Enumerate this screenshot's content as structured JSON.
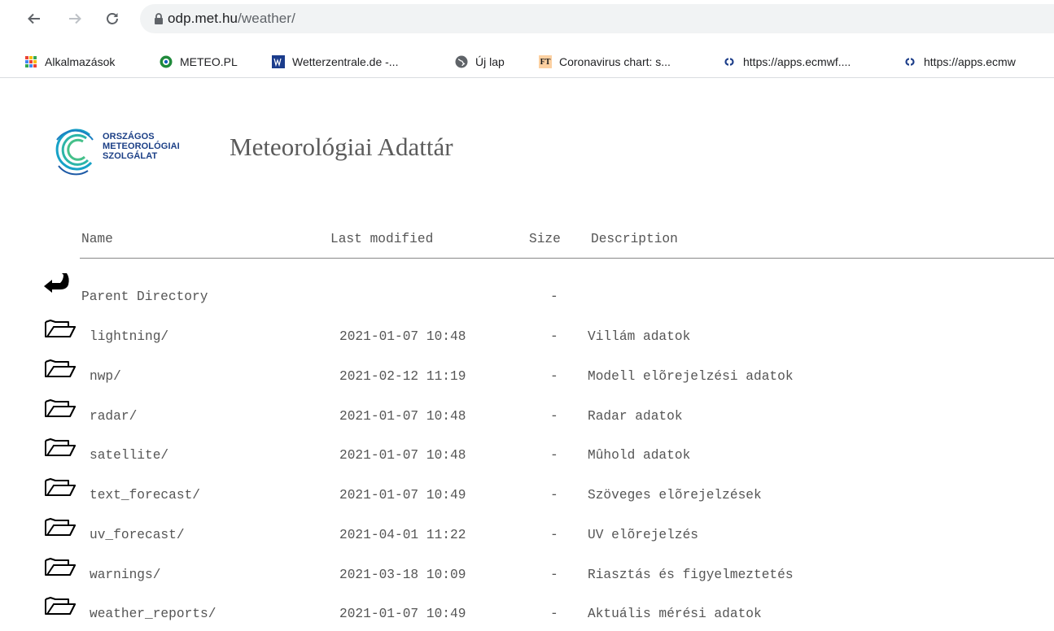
{
  "browser": {
    "url_host": "odp.met.hu",
    "url_path": "/weather/",
    "bookmarks": [
      {
        "label": "Alkalmazások",
        "icon": "apps-grid-icon"
      },
      {
        "label": "METEO.PL",
        "icon": "meteo-pl-icon"
      },
      {
        "label": "Wetterzentrale.de -...",
        "icon": "wetterzentrale-icon"
      },
      {
        "label": "Új lap",
        "icon": "globe-icon"
      },
      {
        "label": "Coronavirus chart: s...",
        "icon": "ft-icon"
      },
      {
        "label": "https://apps.ecmwf....",
        "icon": "ecmwf-icon"
      },
      {
        "label": "https://apps.ecmw",
        "icon": "ecmwf-icon"
      }
    ]
  },
  "site": {
    "logo_lines": [
      "ORSZÁGOS",
      "METEOROLÓGIAI",
      "SZOLGÁLAT"
    ],
    "title": "Meteorológiai Adattár"
  },
  "table": {
    "headers": {
      "name": "Name",
      "modified": "Last modified",
      "size": "Size",
      "description": "Description"
    },
    "parent": {
      "name": "Parent Directory",
      "size": "-"
    },
    "rows": [
      {
        "name": "lightning/",
        "modified": "2021-01-07 10:48",
        "size": "-",
        "description": "Villám adatok"
      },
      {
        "name": "nwp/",
        "modified": "2021-02-12 11:19",
        "size": "-",
        "description": "Modell elõrejelzési adatok"
      },
      {
        "name": "radar/",
        "modified": "2021-01-07 10:48",
        "size": "-",
        "description": "Radar adatok"
      },
      {
        "name": "satellite/",
        "modified": "2021-01-07 10:48",
        "size": "-",
        "description": "Mûhold adatok"
      },
      {
        "name": "text_forecast/",
        "modified": "2021-01-07 10:49",
        "size": "-",
        "description": "Szöveges elõrejelzések"
      },
      {
        "name": "uv_forecast/",
        "modified": "2021-04-01 11:22",
        "size": "-",
        "description": "UV elõrejelzés"
      },
      {
        "name": "warnings/",
        "modified": "2021-03-18 10:09",
        "size": "-",
        "description": "Riasztás és figyelmeztetés"
      },
      {
        "name": "weather_reports/",
        "modified": "2021-01-07 10:49",
        "size": "-",
        "description": "Aktuális mérési adatok"
      }
    ]
  }
}
